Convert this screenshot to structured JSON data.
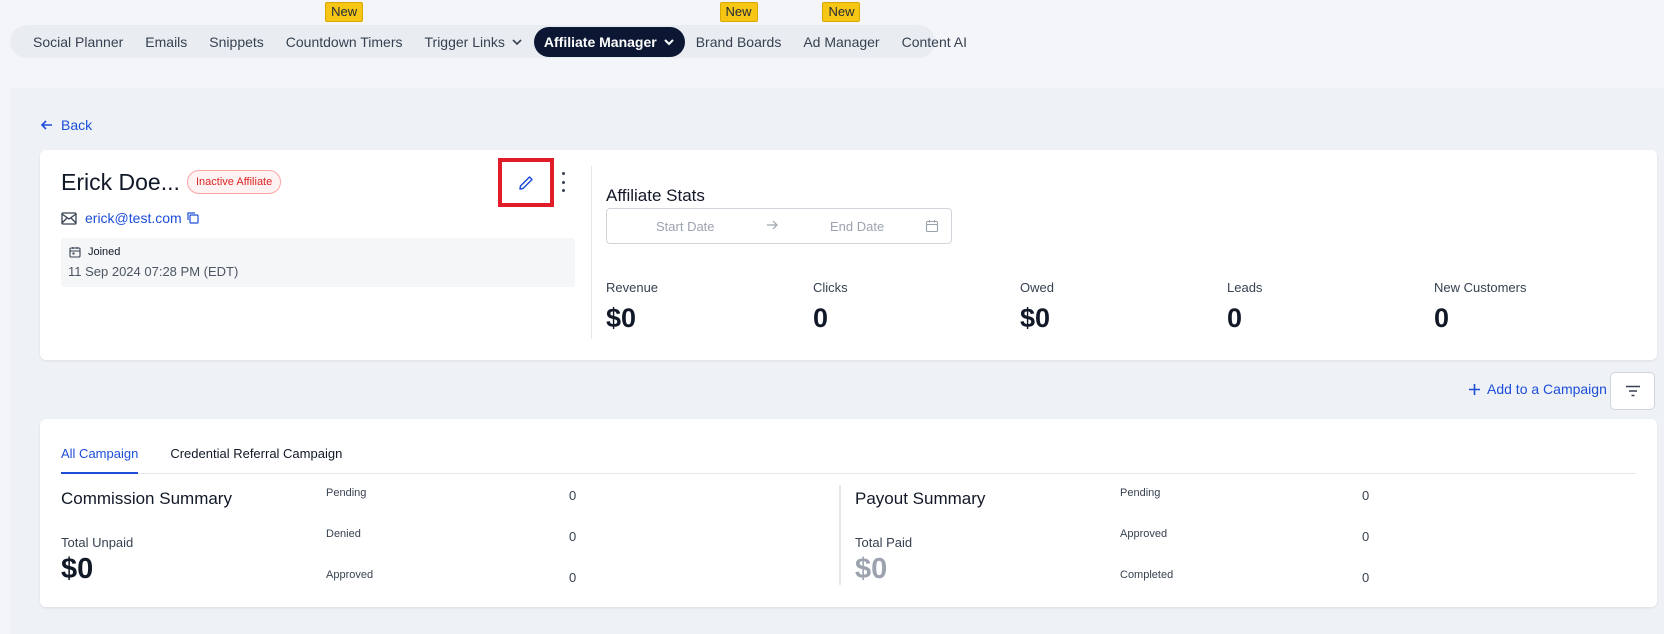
{
  "nav": {
    "items": [
      {
        "label": "Social Planner",
        "badge": ""
      },
      {
        "label": "Emails",
        "badge": ""
      },
      {
        "label": "Snippets",
        "badge": ""
      },
      {
        "label": "Countdown Timers",
        "badge": "New"
      },
      {
        "label": "Trigger Links",
        "badge": ""
      },
      {
        "label": "Affiliate Manager",
        "badge": ""
      },
      {
        "label": "Brand Boards",
        "badge": "New"
      },
      {
        "label": "Ad Manager",
        "badge": "New"
      },
      {
        "label": "Content AI",
        "badge": ""
      }
    ]
  },
  "back_label": "Back",
  "affiliate": {
    "name": "Erick Doe...",
    "status": "Inactive Affiliate",
    "email": "erick@test.com",
    "joined_label": "Joined",
    "joined_value": "11 Sep 2024 07:28 PM (EDT)"
  },
  "stats": {
    "title": "Affiliate Stats",
    "start_placeholder": "Start Date",
    "end_placeholder": "End Date",
    "items": [
      {
        "label": "Revenue",
        "value": "$0"
      },
      {
        "label": "Clicks",
        "value": "0"
      },
      {
        "label": "Owed",
        "value": "$0"
      },
      {
        "label": "Leads",
        "value": "0"
      },
      {
        "label": "New Customers",
        "value": "0"
      }
    ]
  },
  "add_campaign_label": "Add to a Campaign",
  "tabs": [
    "All Campaign",
    "Credential Referral Campaign"
  ],
  "commission": {
    "title": "Commission Summary",
    "total_label": "Total Unpaid",
    "total_value": "$0",
    "rows": [
      {
        "label": "Pending",
        "value": "0"
      },
      {
        "label": "Denied",
        "value": "0"
      },
      {
        "label": "Approved",
        "value": "0"
      }
    ]
  },
  "payout": {
    "title": "Payout Summary",
    "total_label": "Total Paid",
    "total_value": "$0",
    "rows": [
      {
        "label": "Pending",
        "value": "0"
      },
      {
        "label": "Approved",
        "value": "0"
      },
      {
        "label": "Completed",
        "value": "0"
      }
    ]
  },
  "colors": {
    "accent": "#1d4ed8",
    "nav_active": "#0b1733",
    "badge_new": "#f7c614",
    "inactive": "#dc2626",
    "highlight_box": "#e11d2a"
  }
}
